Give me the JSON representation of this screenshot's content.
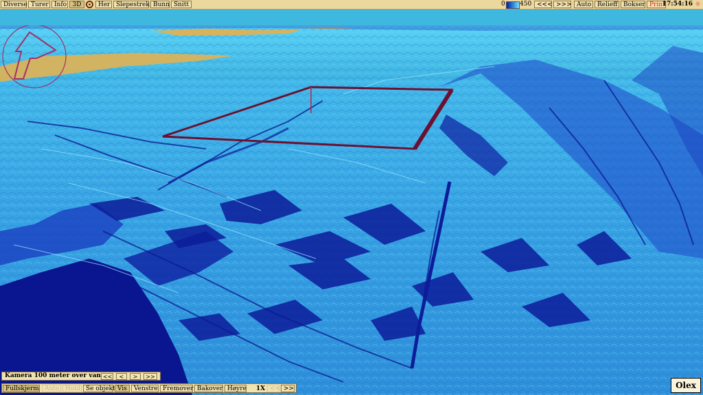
{
  "toolbar": {
    "items": [
      "Diverse",
      "Turer",
      "Info",
      "3D",
      "Her",
      "Slepestrek",
      "Bunn",
      "Snitt"
    ],
    "active": "3D",
    "right": {
      "legend_min": "0",
      "legend_max": "450",
      "prev": "<<<",
      "next": ">>>",
      "auto": "Auto",
      "relief": "Relieff",
      "boxes": "Bokser",
      "print": "Print",
      "clock": "17:54:16"
    }
  },
  "camera": {
    "label": "Kamera 100 meter over vann",
    "buttons": [
      "<<",
      "<",
      ">",
      ">>"
    ]
  },
  "bottom": {
    "buttons": [
      "Fullskjerm",
      "Auto",
      "Hold",
      "Se objekt",
      "Vis",
      "Venstre",
      "Fremover",
      "Bakover",
      "Høyre"
    ],
    "dimmed": [
      "Auto",
      "Hold"
    ],
    "active": [
      "Fullskjerm",
      "Vis"
    ],
    "speed": "1X",
    "speed_prev": "<<",
    "speed_next": ">>"
  },
  "brand": "Olex",
  "colors": {
    "shallow": "#7ee0ff",
    "mid": "#3aa6e6",
    "deep": "#1a3fc0",
    "deepest": "#0a168f",
    "land": "#d9b25a",
    "box_outline": "#6b1030",
    "ui_bg": "#ecd79e"
  },
  "icons": [
    "compass-arrow-icon",
    "target-icon",
    "sun-icon"
  ]
}
